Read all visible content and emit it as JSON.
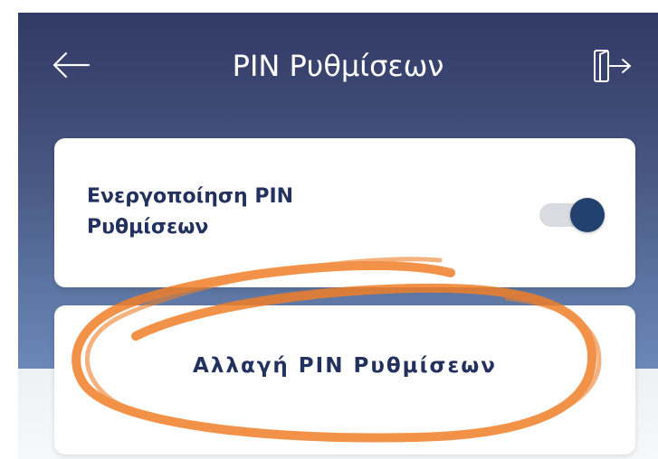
{
  "header": {
    "title": "PIN Ρυθμίσεων",
    "back_icon": "arrow-left-icon",
    "exit_icon": "logout-door-icon"
  },
  "settings": {
    "toggle_label": "Ενεργοποίηση PIN Ρυθμίσεων",
    "toggle_on": true,
    "change_label": "Αλλαγή PIN Ρυθμίσεων"
  },
  "colors": {
    "header_top": "#323a66",
    "header_bottom": "#6b88b8",
    "text_primary": "#22315e",
    "toggle_thumb": "#22416e",
    "toggle_track": "#d9dbe0",
    "annotation": "#f07f2a"
  }
}
